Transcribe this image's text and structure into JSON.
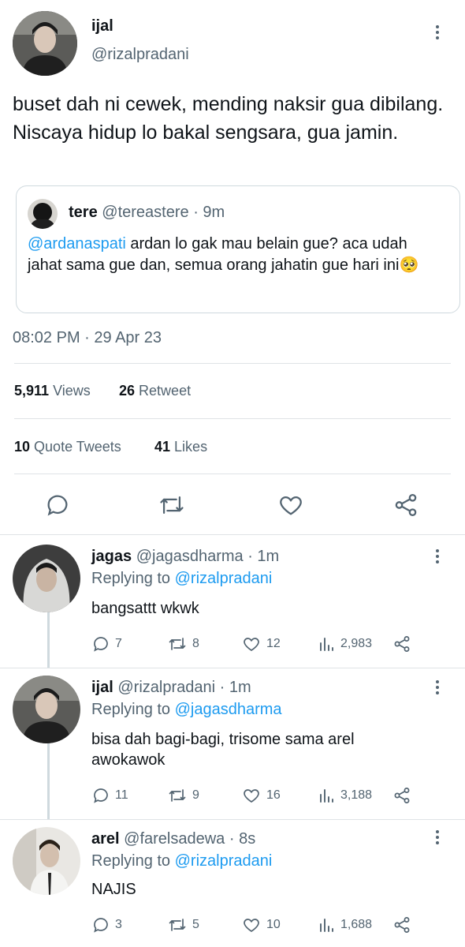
{
  "main_tweet": {
    "name": "ijal",
    "handle": "@rizalpradani",
    "text": "buset dah ni cewek, mending naksir gua dibilang. Niscaya hidup lo bakal sengsara, gua jamin.",
    "quoted": {
      "name": "tere",
      "handle": "@tereastere",
      "time": "· 9m",
      "mention": "@ardanaspati",
      "text": " ardan lo gak mau belain gue? aca udah jahat sama gue dan, semua orang jahatin gue hari ini",
      "emoji": "🥺"
    },
    "timestamp": "08:02 PM · 29 Apr 23",
    "views_count": "5,911",
    "views_label": "Views",
    "retweets_count": "26",
    "retweets_label": "Retweet",
    "quotes_count": "10",
    "quotes_label": "Quote Tweets",
    "likes_count": "41",
    "likes_label": "Likes"
  },
  "replies": [
    {
      "name": "jagas",
      "handle": "@jagasdharma",
      "time": "· 1m",
      "replying_prefix": "Replying to ",
      "replying_to": "@rizalpradani",
      "text": "bangsattt wkwk",
      "replies": "7",
      "retweets": "8",
      "likes": "12",
      "views": "2,983"
    },
    {
      "name": "ijal",
      "handle": "@rizalpradani",
      "time": "· 1m",
      "replying_prefix": "Replying to ",
      "replying_to": "@jagasdharma",
      "text_line1": "bisa dah bagi-bagi, trisome sama arel",
      "text_line2": "awokawok",
      "replies": "11",
      "retweets": "9",
      "likes": "16",
      "views": "3,188"
    },
    {
      "name": "arel",
      "handle": "@farelsadewa",
      "time": "· 8s",
      "replying_prefix": "Replying to ",
      "replying_to": "@rizalpradani",
      "text": "NAJIS",
      "replies": "3",
      "retweets": "5",
      "likes": "10",
      "views": "1,688"
    }
  ],
  "colors": {
    "link": "#1d9bf0",
    "muted": "#536471",
    "divider": "#dfe3e6"
  }
}
